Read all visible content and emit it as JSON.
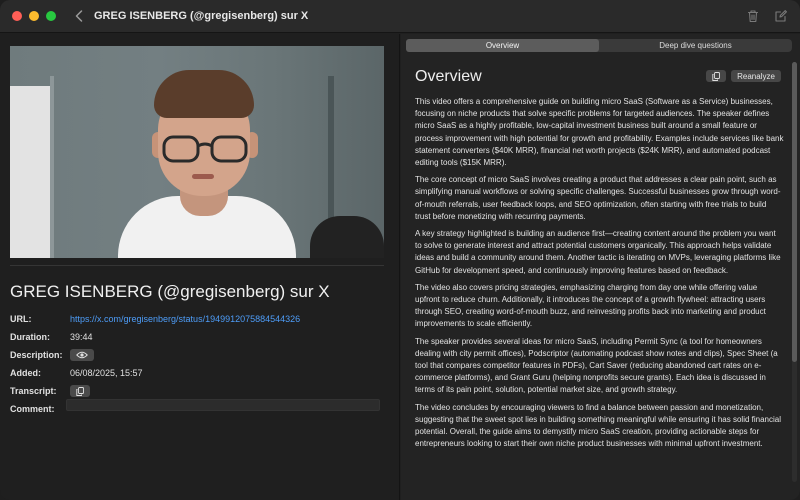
{
  "window": {
    "title": "GREG ISENBERG (@gregisenberg) sur X"
  },
  "header": {
    "page_title": "GREG ISENBERG (@gregisenberg) sur X"
  },
  "meta": {
    "url_label": "URL:",
    "url_value": "https://x.com/gregisenberg/status/1949912075884544326",
    "duration_label": "Duration:",
    "duration_value": "39:44",
    "description_label": "Description:",
    "added_label": "Added:",
    "added_value": "06/08/2025, 15:57",
    "transcript_label": "Transcript:",
    "comment_label": "Comment:"
  },
  "tabs": [
    {
      "label": "Overview",
      "active": true
    },
    {
      "label": "Deep dive questions",
      "active": false
    }
  ],
  "overview": {
    "title": "Overview",
    "reanalyze_label": "Reanalyze",
    "paragraphs": [
      "This video offers a comprehensive guide on building micro SaaS (Software as a Service) businesses, focusing on niche products that solve specific problems for targeted audiences. The speaker defines micro SaaS as a highly profitable, low-capital investment business built around a small feature or process improvement with high potential for growth and profitability. Examples include services like bank statement converters ($40K MRR), financial net worth projects ($24K MRR), and automated podcast editing tools ($15K MRR).",
      "The core concept of micro SaaS involves creating a product that addresses a clear pain point, such as simplifying manual workflows or solving specific challenges. Successful businesses grow through word-of-mouth referrals, user feedback loops, and SEO optimization, often starting with free trials to build trust before monetizing with recurring payments.",
      "A key strategy highlighted is building an audience first—creating content around the problem you want to solve to generate interest and attract potential customers organically. This approach helps validate ideas and build a community around them. Another tactic is iterating on MVPs, leveraging platforms like GitHub for development speed, and continuously improving features based on feedback.",
      "The video also covers pricing strategies, emphasizing charging from day one while offering value upfront to reduce churn. Additionally, it introduces the concept of a growth flywheel: attracting users through SEO, creating word-of-mouth buzz, and reinvesting profits back into marketing and product improvements to scale efficiently.",
      "The speaker provides several ideas for micro SaaS, including Permit Sync (a tool for homeowners dealing with city permit offices), Podscriptor (automating podcast show notes and clips), Spec Sheet (a tool that compares competitor features in PDFs), Cart Saver (reducing abandoned cart rates on e-commerce platforms), and Grant Guru (helping nonprofits secure grants). Each idea is discussed in terms of its pain point, solution, potential market size, and growth strategy.",
      "The video concludes by encouraging viewers to find a balance between passion and monetization, suggesting that the sweet spot lies in building something meaningful while ensuring it has solid financial potential. Overall, the guide aims to demystify micro SaaS creation, providing actionable steps for entrepreneurs looking to start their own niche product businesses with minimal upfront investment."
    ]
  },
  "icons": {
    "back": "chevron-left-icon",
    "trash": "trash-icon",
    "edit": "compose-icon",
    "eye": "eye-icon",
    "copy": "copy-icon"
  },
  "colors": {
    "link": "#4e9df8",
    "close": "#ff5f57",
    "minimize": "#febc2e",
    "zoom": "#28c840"
  }
}
